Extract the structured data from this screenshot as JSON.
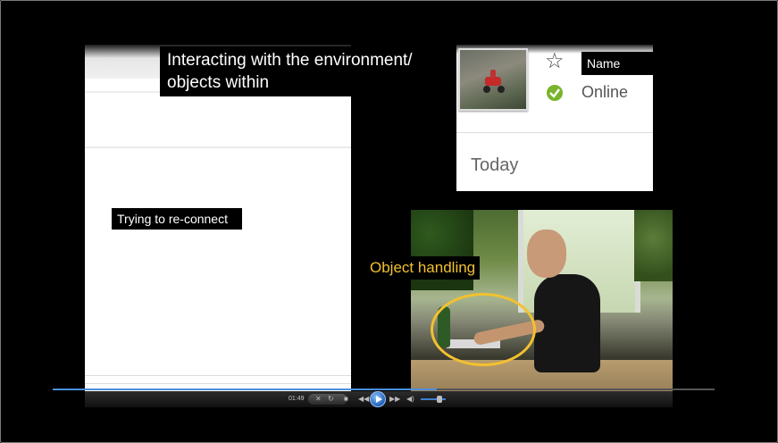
{
  "captions": {
    "interacting": "Interacting with the environment/ objects within",
    "reconnect": "Trying to re-connect",
    "object_handling": "Object handling"
  },
  "profile": {
    "name_label": "Name",
    "status": "Online",
    "section": "Today",
    "icons": [
      "star-icon",
      "online-status-icon"
    ]
  },
  "player": {
    "time": "01:49",
    "progress_fraction": 0.58,
    "volume_fraction": 0.75,
    "icons": [
      "mute-icon",
      "repeat-icon",
      "stop-icon",
      "previous-icon",
      "play-icon",
      "next-icon",
      "volume-icon"
    ]
  },
  "colors": {
    "annotation": "#f2c12e",
    "progress": "#4a8fdc"
  }
}
